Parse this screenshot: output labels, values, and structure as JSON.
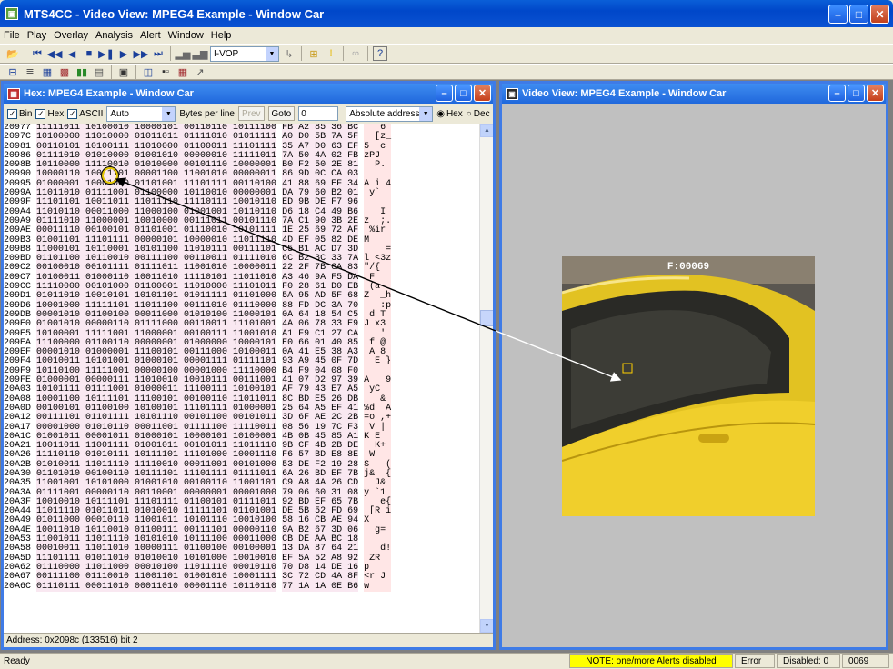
{
  "window": {
    "title": "MTS4CC - Video View: MPEG4 Example - Window Car"
  },
  "menu": [
    "File",
    "Play",
    "Overlay",
    "Analysis",
    "Alert",
    "Window",
    "Help"
  ],
  "toolbar": {
    "frame_type_combo": "I-VOP"
  },
  "hex_window": {
    "title": "Hex: MPEG4 Example - Window Car",
    "bin_label": "Bin",
    "hex_label": "Hex",
    "ascii_label": "ASCII",
    "bytes_combo": "Auto",
    "bytes_per_line_label": "Bytes per line",
    "prev_label": "Prev",
    "goto_label": "Goto",
    "goto_value": "0",
    "address_mode": "Absolute address",
    "radio_hex": "Hex",
    "radio_dec": "Dec",
    "address_status": "Address: 0x2098c (133516) bit 2",
    "rows": [
      {
        "a": "20977",
        "b": "11111011 10100010 10000101 00110110 10111100",
        "h": "FB A2 85 36 BC",
        "t": "   6 "
      },
      {
        "a": "2097C",
        "b": "10100000 11010000 01011011 01111010 01011111",
        "h": "A0 D0 5B 7A 5F",
        "t": "  [z_"
      },
      {
        "a": "20981",
        "b": "00110101 10100111 11010000 01100011 11101111",
        "h": "35 A7 D0 63 EF",
        "t": "5  c "
      },
      {
        "a": "20986",
        "b": "01111010 01010000 01001010 00000010 11111011",
        "h": "7A 50 4A 02 FB",
        "t": "zPJ  "
      },
      {
        "a": "2098B",
        "b": "10110000 11110010 01010000 00101110 10000001",
        "h": "B0 F2 50 2E 81",
        "t": "  P. "
      },
      {
        "a": "20990",
        "b": "10000110 10011101 00001100 11001010 00000011",
        "h": "86 9D 0C CA 03",
        "t": "     "
      },
      {
        "a": "20995",
        "b": "01000001 10001000 01101001 11101111 00110100",
        "h": "41 88 69 EF 34",
        "t": "A i 4"
      },
      {
        "a": "2099A",
        "b": "11011010 01111001 01100000 10110010 00000001",
        "h": "DA 79 60 B2 01",
        "t": " y`  "
      },
      {
        "a": "2099F",
        "b": "11101101 10011011 11011110 11110111 10010110",
        "h": "ED 9B DE F7 96",
        "t": "     "
      },
      {
        "a": "209A4",
        "b": "11010110 00011000 11000100 01001001 10110110",
        "h": "D6 18 C4 49 B6",
        "t": "   I "
      },
      {
        "a": "209A9",
        "b": "01111010 11000001 10010000 00111011 00101110",
        "h": "7A C1 90 3B 2E",
        "t": "z  ;."
      },
      {
        "a": "209AE",
        "b": "00011110 00100101 01101001 01110010 10101111",
        "h": "1E 25 69 72 AF",
        "t": " %ir "
      },
      {
        "a": "209B3",
        "b": "01001101 11101111 00000101 10000010 11011110",
        "h": "4D EF 05 82 DE",
        "t": "M    "
      },
      {
        "a": "209B8",
        "b": "11000101 10110001 10101100 11010111 00111101",
        "h": "C5 B1 AC D7 3D",
        "t": "    ="
      },
      {
        "a": "209BD",
        "b": "01101100 10110010 00111100 00110011 01111010",
        "h": "6C B2 3C 33 7A",
        "t": "l <3z"
      },
      {
        "a": "209C2",
        "b": "00100010 00101111 01111011 11001010 10000011",
        "h": "22 2F 7B CA 83",
        "t": "\"/{  "
      },
      {
        "a": "209C7",
        "b": "10100011 01000110 10011010 11110101 11011010",
        "h": "A3 46 9A F5 DA",
        "t": " F   "
      },
      {
        "a": "209CC",
        "b": "11110000 00101000 01100001 11010000 11101011",
        "h": "F0 28 61 D0 EB",
        "t": " (a  "
      },
      {
        "a": "209D1",
        "b": "01011010 10010101 10101101 01011111 01101000",
        "h": "5A 95 AD 5F 68",
        "t": "Z  _h"
      },
      {
        "a": "209D6",
        "b": "10001000 11111101 11011100 00111010 01110000",
        "h": "88 FD DC 3A 70",
        "t": "   :p"
      },
      {
        "a": "209DB",
        "b": "00001010 01100100 00011000 01010100 11000101",
        "h": "0A 64 18 54 C5",
        "t": " d T "
      },
      {
        "a": "209E0",
        "b": "01001010 00000110 01111000 00110011 11101001",
        "h": "4A 06 78 33 E9",
        "t": "J x3 "
      },
      {
        "a": "209E5",
        "b": "10100001 11111001 11000001 00100111 11001010",
        "h": "A1 F9 C1 27 CA",
        "t": "   ' "
      },
      {
        "a": "209EA",
        "b": "11100000 01100110 00000001 01000000 10000101",
        "h": "E0 66 01 40 85",
        "t": " f @ "
      },
      {
        "a": "209EF",
        "b": "00001010 01000001 11100101 00111000 10100011",
        "h": "0A 41 E5 38 A3",
        "t": " A 8 "
      },
      {
        "a": "209F4",
        "b": "10010011 10101001 01000101 00001111 01111101",
        "h": "93 A9 45 0F 7D",
        "t": "  E }"
      },
      {
        "a": "209F9",
        "b": "10110100 11111001 00000100 00001000 11110000",
        "h": "B4 F9 04 08 F0",
        "t": "     "
      },
      {
        "a": "209FE",
        "b": "01000001 00000111 11010010 10010111 00111001",
        "h": "41 07 D2 97 39",
        "t": "A   9"
      },
      {
        "a": "20A03",
        "b": "10101111 01111001 01000011 11100111 10100101",
        "h": "AF 79 43 E7 A5",
        "t": " yC  "
      },
      {
        "a": "20A08",
        "b": "10001100 10111101 11100101 00100110 11011011",
        "h": "8C BD E5 26 DB",
        "t": "   & "
      },
      {
        "a": "20A0D",
        "b": "00100101 01100100 10100101 11101111 01000001",
        "h": "25 64 A5 EF 41",
        "t": "%d  A"
      },
      {
        "a": "20A12",
        "b": "00111101 01101111 10101110 00101100 00101011",
        "h": "3D 6F AE 2C 2B",
        "t": "=o ,+"
      },
      {
        "a": "20A17",
        "b": "00001000 01010110 00011001 01111100 11110011",
        "h": "08 56 19 7C F3",
        "t": " V | "
      },
      {
        "a": "20A1C",
        "b": "01001011 00001011 01000101 10000101 10100001",
        "h": "4B 0B 45 85 A1",
        "t": "K E  "
      },
      {
        "a": "20A21",
        "b": "10011011 11001111 01001011 00101011 11011110",
        "h": "9B CF 4B 2B DE",
        "t": "  K+ "
      },
      {
        "a": "20A26",
        "b": "11110110 01010111 10111101 11101000 10001110",
        "h": "F6 57 BD E8 8E",
        "t": " W   "
      },
      {
        "a": "20A2B",
        "b": "01010011 11011110 11110010 00011001 00101000",
        "h": "53 DE F2 19 28",
        "t": "S   ("
      },
      {
        "a": "20A30",
        "b": "01101010 00100110 10111101 11101111 01111011",
        "h": "6A 26 BD EF 7B",
        "t": "j&  {"
      },
      {
        "a": "20A35",
        "b": "11001001 10101000 01001010 00100110 11001101",
        "h": "C9 A8 4A 26 CD",
        "t": "  J& "
      },
      {
        "a": "20A3A",
        "b": "01111001 00000110 00110001 00000001 00001000",
        "h": "79 06 60 31 08",
        "t": "y `1 "
      },
      {
        "a": "20A3F",
        "b": "10010010 10111101 11101111 01100101 01111011",
        "h": "92 BD EF 65 7B",
        "t": "   e{"
      },
      {
        "a": "20A44",
        "b": "11011110 01011011 01010010 11111101 01101001",
        "h": "DE 5B 52 FD 69",
        "t": " [R i"
      },
      {
        "a": "20A49",
        "b": "01011000 00010110 11001011 10101110 10010100",
        "h": "58 16 CB AE 94",
        "t": "X    "
      },
      {
        "a": "20A4E",
        "b": "10011010 10110010 01100111 00111101 00000110",
        "h": "9A B2 67 3D 06",
        "t": "  g= "
      },
      {
        "a": "20A53",
        "b": "11001011 11011110 10101010 10111100 00011000",
        "h": "CB DE AA BC 18",
        "t": "     "
      },
      {
        "a": "20A58",
        "b": "00010011 11011010 10000111 01100100 00100001",
        "h": "13 DA 87 64 21",
        "t": "   d!"
      },
      {
        "a": "20A5D",
        "b": "11101111 01011010 01010010 10101000 10010010",
        "h": "EF 5A 52 A8 92",
        "t": " ZR  "
      },
      {
        "a": "20A62",
        "b": "01110000 11011000 00010100 11011110 00010110",
        "h": "70 D8 14 DE 16",
        "t": "p    "
      },
      {
        "a": "20A67",
        "b": "00111100 01110010 11001101 01001010 10001111",
        "h": "3C 72 CD 4A 8F",
        "t": "<r J "
      },
      {
        "a": "20A6C",
        "b": "01110111 00011010 00011010 00001110 10110110",
        "h": "77 1A 1A 0E B6",
        "t": "w    "
      }
    ]
  },
  "video_window": {
    "title": "Video View: MPEG4 Example - Window Car",
    "frame_label": "F:00069"
  },
  "status": {
    "ready": "Ready",
    "alert": "NOTE: one/more Alerts disabled",
    "error": "Error",
    "disabled": "Disabled: 0",
    "frame": "0069"
  }
}
